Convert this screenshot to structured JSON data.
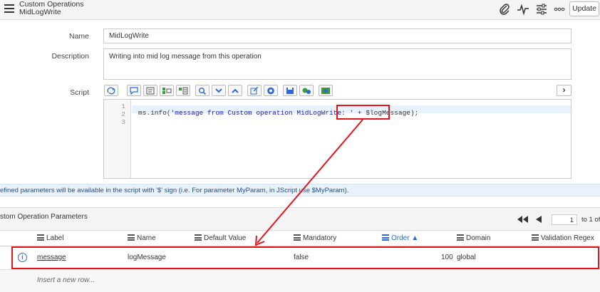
{
  "header": {
    "title": "Custom Operations",
    "subtitle": "MidLogWrite",
    "update_label": "Update",
    "icons": [
      "paperclip-icon",
      "activity-icon",
      "settings-sliders-icon",
      "more-options-icon"
    ]
  },
  "form": {
    "name_label": "Name",
    "name_value": "MidLogWrite",
    "description_label": "Description",
    "description_value": "Writing into mid log message from this operation",
    "script_label": "Script"
  },
  "editor": {
    "line_numbers": [
      "1",
      "2",
      "3"
    ],
    "code_prefix": "ms.info(",
    "code_string": "'message from Custom operation MidLogWrite: '",
    "code_plus": " + ",
    "code_variable": "$logMessage);"
  },
  "info_bar": {
    "text": "efined parameters will be available in the script with '$' sign (i.e. For parameter MyParam, in JScript use $MyParam)."
  },
  "related_list": {
    "title": "stom Operation Parameters",
    "page_value": "1",
    "page_of": "to 1 of"
  },
  "table": {
    "columns": [
      "Label",
      "Name",
      "Default Value",
      "Mandatory",
      "Order ▲",
      "Domain",
      "Validation Regex"
    ],
    "rows": [
      {
        "label": "message",
        "name": "logMessage",
        "default_value": "",
        "mandatory": "false",
        "order": "100",
        "domain": "global",
        "validation_regex": ""
      }
    ],
    "insert_row_text": "Insert a new row..."
  },
  "colors": {
    "annotation_red": "#e3141a",
    "link_blue": "#2a6ad6",
    "info_bar_bg": "#e9f2fb"
  }
}
